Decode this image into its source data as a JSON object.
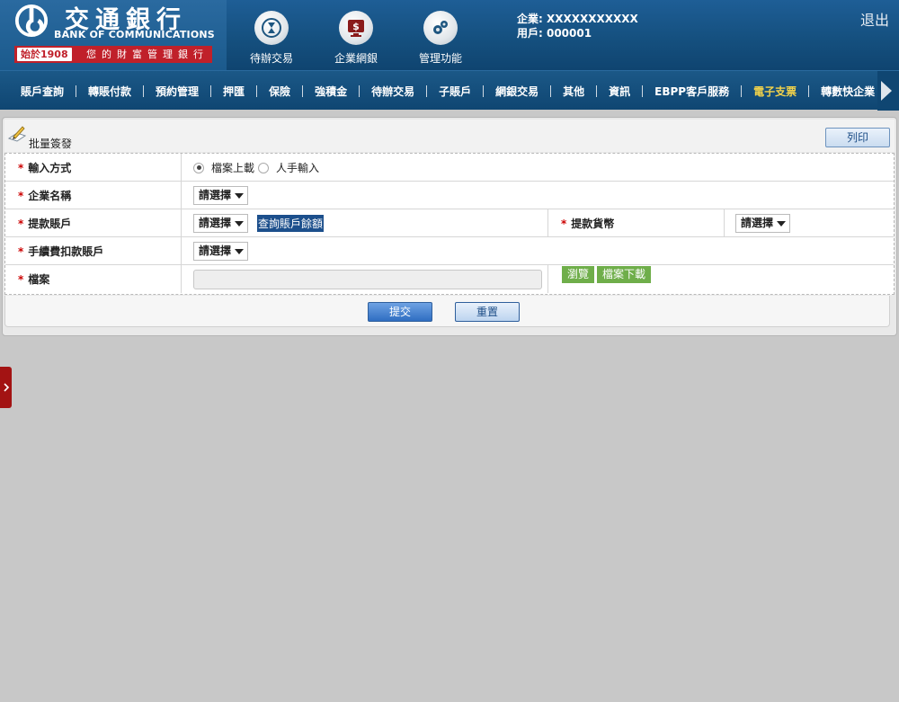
{
  "brand": {
    "name_cn": "交通銀行",
    "name_en": "BANK OF COMMUNICATIONS",
    "since": "始於1908",
    "slogan": "您的財富管理銀行"
  },
  "top_icons": [
    {
      "label": "待辦交易",
      "icon": "hourglass-icon"
    },
    {
      "label": "企業網銀",
      "icon": "dollar-monitor-icon"
    },
    {
      "label": "管理功能",
      "icon": "gears-icon"
    }
  ],
  "user": {
    "company": "企業: XXXXXXXXXXX",
    "user_id": "用戶: 000001"
  },
  "logout": "退出",
  "nav": {
    "items": [
      "賬戶查詢",
      "轉賬付款",
      "預約管理",
      "押匯",
      "保險",
      "強積金",
      "待辦交易",
      "子賬戶",
      "網銀交易",
      "其他",
      "資訊",
      "EBPP客戶服務",
      "電子支票",
      "轉數快企業"
    ],
    "active": "電子支票"
  },
  "panel": {
    "title": "批量簽發",
    "print_label": "列印"
  },
  "form": {
    "input_method": {
      "label": "輸入方式",
      "options": [
        "檔案上載",
        "人手輸入"
      ],
      "selected": "檔案上載"
    },
    "company_name": {
      "label": "企業名稱",
      "select": "請選擇"
    },
    "debit_account": {
      "label": "提款賬戶",
      "select": "請選擇",
      "query_link": "查詢賬戶餘額"
    },
    "debit_currency": {
      "label": "提款貨幣",
      "select": "請選擇"
    },
    "fee_account": {
      "label": "手續費扣款賬戶",
      "select": "請選擇"
    },
    "file": {
      "label": "檔案",
      "browse": "瀏覽",
      "download": "檔案下載"
    }
  },
  "actions": {
    "submit": "提交",
    "reset": "重置"
  },
  "colors": {
    "header_blue": "#15507f",
    "nav_active": "#f3d34a",
    "required_star": "#cc0000",
    "green_button": "#6fae4a",
    "side_tab": "#a31313"
  }
}
